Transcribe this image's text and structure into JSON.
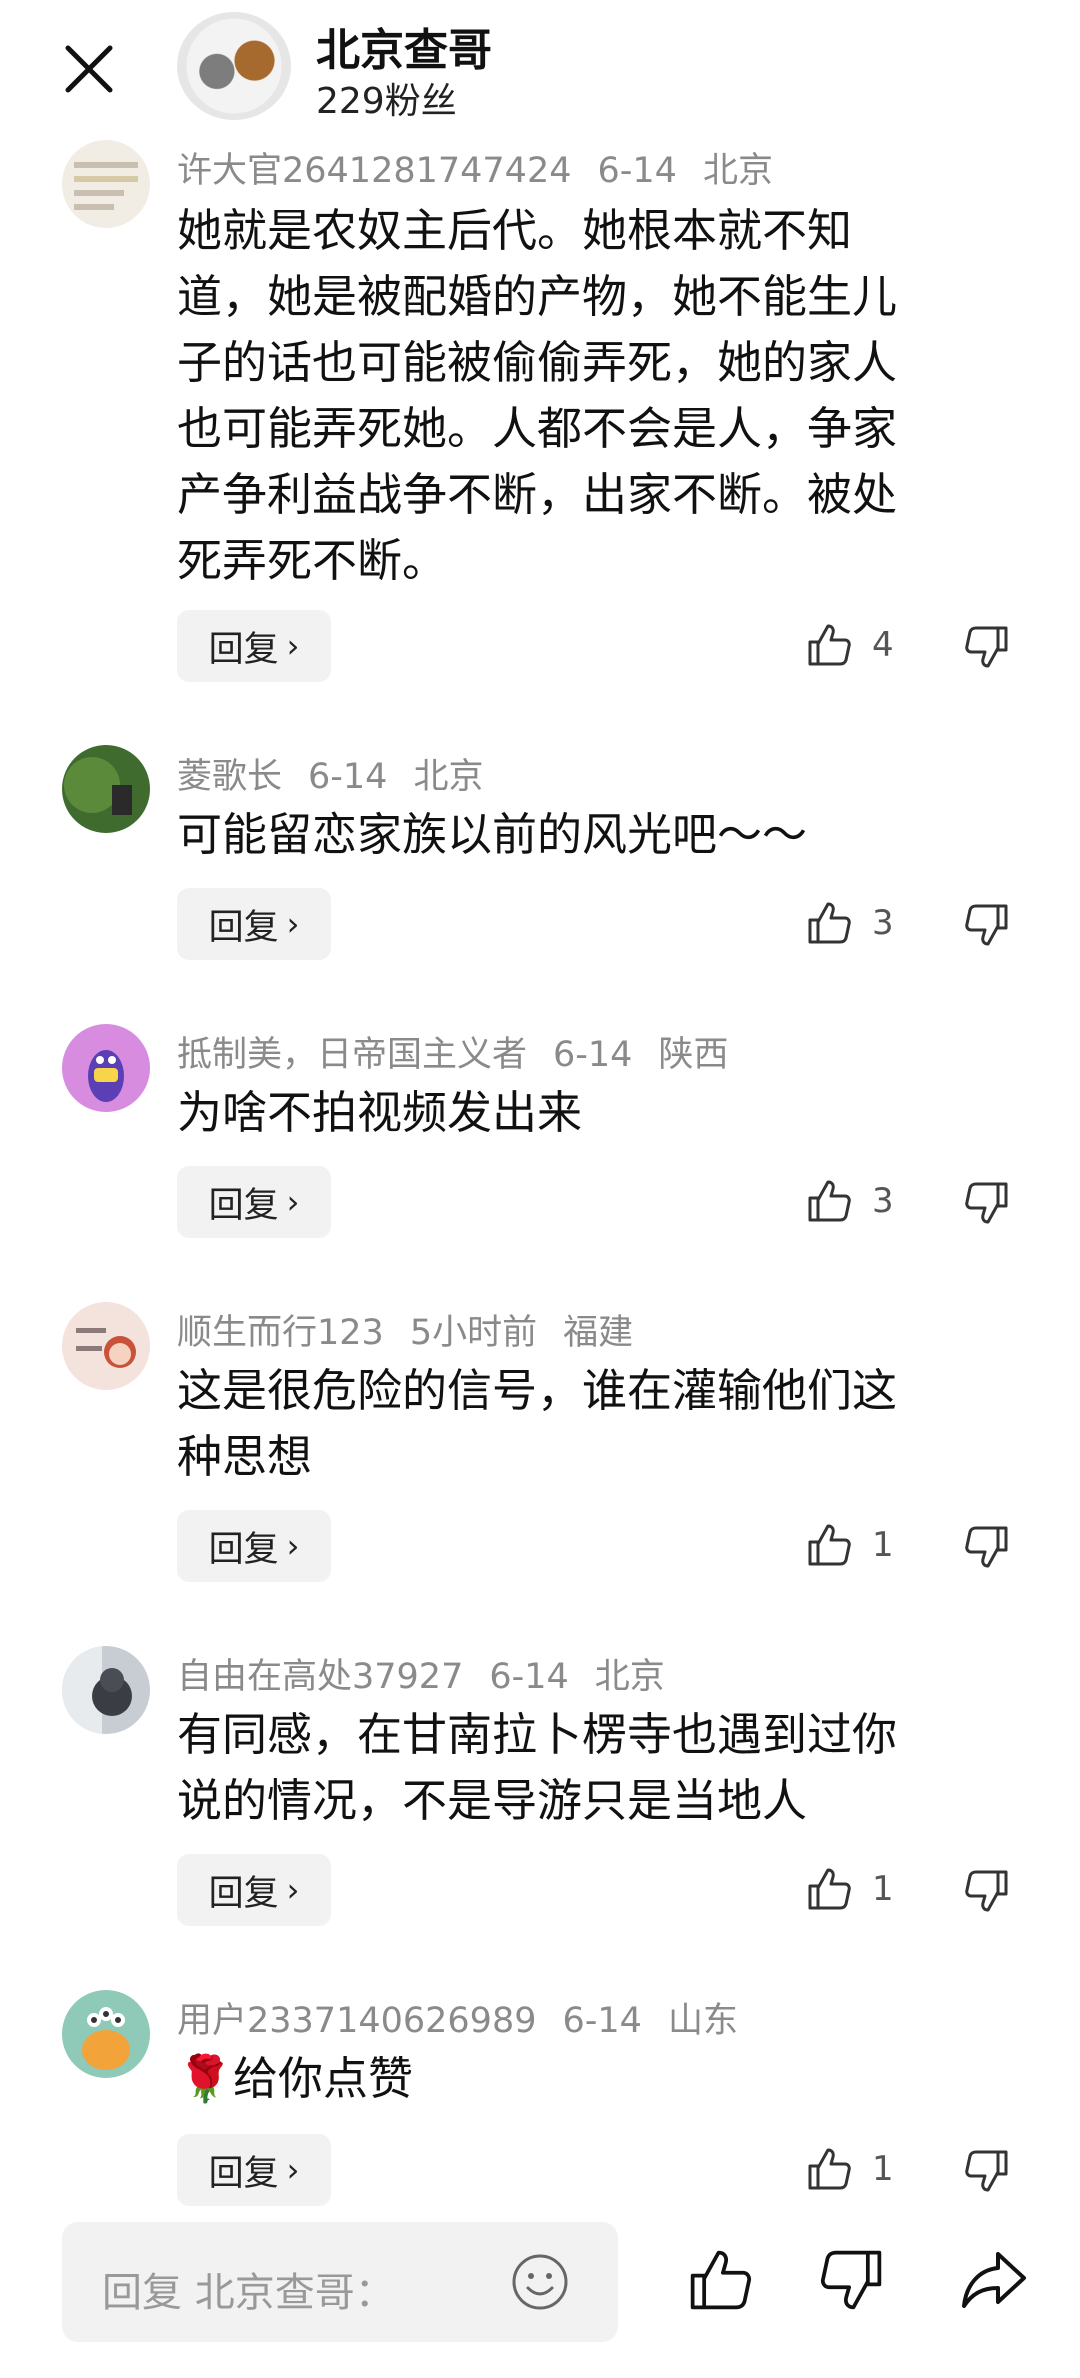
{
  "header": {
    "title": "北京查哥",
    "followers": "229粉丝"
  },
  "comments": [
    {
      "author": "许大官2641281747424",
      "date": "6-14",
      "location": "北京",
      "lines": [
        "她就是农奴主后代。她根本就不知",
        "道，她是被配婚的产物，她不能生儿",
        "子的话也可能被偷偷弄死，她的家人",
        "也可能弄死她。人都不会是人，争家",
        "产争利益战争不断，出家不断。被处",
        "死弄死不断。"
      ],
      "reply_label": "回复",
      "likes": "4"
    },
    {
      "author": "菱歌长",
      "date": "6-14",
      "location": "北京",
      "lines": [
        "可能留恋家族以前的风光吧～～"
      ],
      "reply_label": "回复",
      "likes": "3"
    },
    {
      "author": "抵制美，日帝国主义者",
      "date": "6-14",
      "location": "陕西",
      "lines": [
        "为啥不拍视频发出来"
      ],
      "reply_label": "回复",
      "likes": "3"
    },
    {
      "author": "顺生而行123",
      "date": "5小时前",
      "location": "福建",
      "lines": [
        "这是很危险的信号，谁在灌输他们这",
        "种思想"
      ],
      "reply_label": "回复",
      "likes": "1"
    },
    {
      "author": "自由在高处37927",
      "date": "6-14",
      "location": "北京",
      "lines": [
        "有同感，在甘南拉卜楞寺也遇到过你",
        "说的情况，不是导游只是当地人"
      ],
      "reply_label": "回复",
      "likes": "1"
    },
    {
      "author": "用户2337140626989",
      "date": "6-14",
      "location": "山东",
      "lines": [
        "🌹给你点赞"
      ],
      "reply_label": "回复",
      "likes": "1"
    }
  ],
  "bottom_bar": {
    "input_placeholder": "回复 北京查哥："
  }
}
